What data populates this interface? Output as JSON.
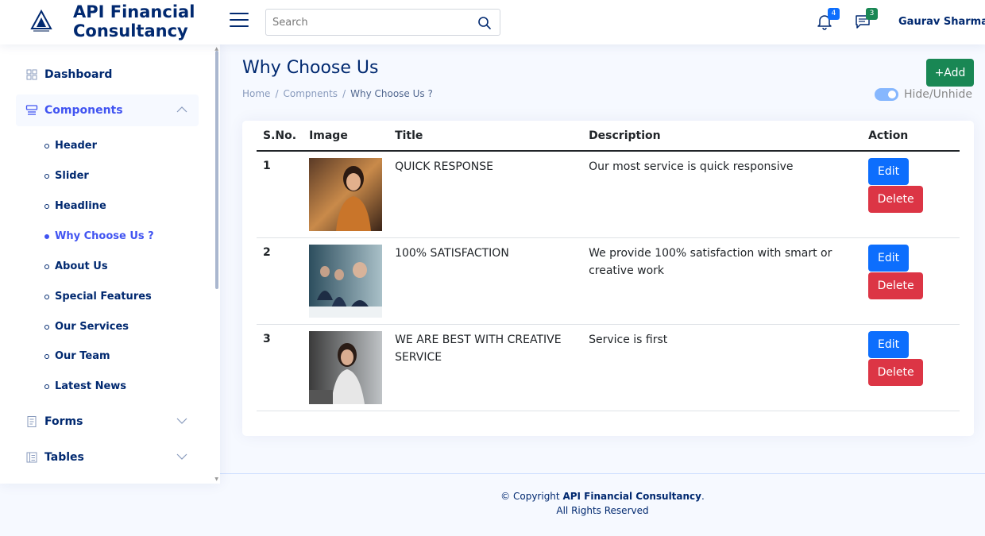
{
  "brand": {
    "line1": "API Financial",
    "line2": "Consultancy"
  },
  "search": {
    "placeholder": "Search"
  },
  "notifications": {
    "count": "4",
    "badge_color": "#0d6efd"
  },
  "messages": {
    "count": "3",
    "badge_color": "#198754"
  },
  "user": {
    "name": "Gaurav Sharma"
  },
  "sidebar": {
    "dashboard": "Dashboard",
    "components": "Components",
    "sub_items": [
      "Header",
      "Slider",
      "Headline",
      "Why Choose Us ?",
      "About Us",
      "Special Features",
      "Our Services",
      "Our Team",
      "Latest News"
    ],
    "active_sub": "Why Choose Us ?",
    "forms": "Forms",
    "tables": "Tables"
  },
  "page": {
    "title": "Why Choose Us",
    "breadcrumb": [
      "Home",
      "Compnents",
      "Why Choose Us ?"
    ],
    "add_label": "+Add",
    "toggle_label": "Hide/Unhide",
    "toggle_on": true
  },
  "table": {
    "headers": [
      "S.No.",
      "Image",
      "Title",
      "Description",
      "Action"
    ],
    "rows": [
      {
        "sno": "1",
        "image": "woman-portrait-photo",
        "title": "QUICK RESPONSE",
        "description": "Our most service is quick responsive",
        "edit": "Edit",
        "delete": "Delete"
      },
      {
        "sno": "2",
        "image": "business-team-photo",
        "title": "100% SATISFACTION",
        "description": "We provide 100% satisfaction with smart or creative work",
        "edit": "Edit",
        "delete": "Delete"
      },
      {
        "sno": "3",
        "image": "woman-office-photo",
        "title": "WE ARE BEST WITH CREATIVE SERVICE",
        "description": "Service is first",
        "edit": "Edit",
        "delete": "Delete"
      }
    ]
  },
  "footer": {
    "prefix": "© Copyright",
    "company": "API Financial Consultancy",
    "suffix": ".",
    "rights": "All Rights Reserved"
  },
  "colors": {
    "primary": "#012970",
    "accent": "#4154f1",
    "add": "#198754",
    "edit": "#0d6efd",
    "delete": "#dc3545"
  }
}
